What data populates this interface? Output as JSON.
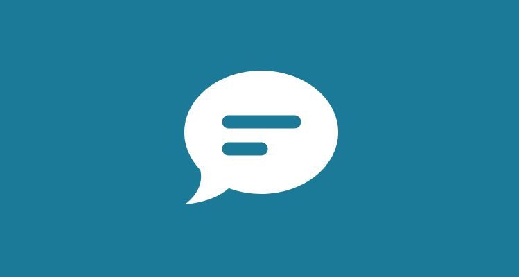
{
  "background": {
    "color": "#1b7a97"
  },
  "icon": {
    "name": "speech-bubble-icon",
    "fill_color": "#ffffff",
    "line_color": "#1b7a97"
  }
}
